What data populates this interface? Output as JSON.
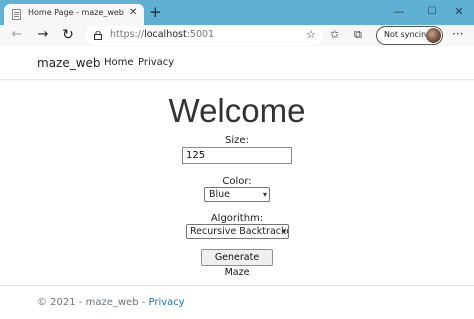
{
  "browser": {
    "tab_title": "Home Page - maze_web",
    "tab_close": "✕",
    "new_tab": "+",
    "url_scheme": "https://",
    "url_host": "localhost",
    "url_port": ":5001",
    "sync_label": "Not syncing",
    "controls": {
      "minimize": "—",
      "maximize": "☐",
      "close": "✕"
    }
  },
  "navbar": {
    "brand": "maze_web",
    "links": [
      "Home",
      "Privacy"
    ]
  },
  "main": {
    "heading": "Welcome",
    "size_label": "Size:",
    "size_value": "125",
    "color_label": "Color:",
    "color_selected": "Blue",
    "algorithm_label": "Algorithm:",
    "algorithm_selected": "Recursive Backtracker",
    "generate_button": "Generate Maze"
  },
  "footer": {
    "copyright": "© 2021 - maze_web - ",
    "privacy_link": "Privacy"
  },
  "colors": {
    "titlebar": "#5fb0d3",
    "link": "#1b6ec2"
  }
}
